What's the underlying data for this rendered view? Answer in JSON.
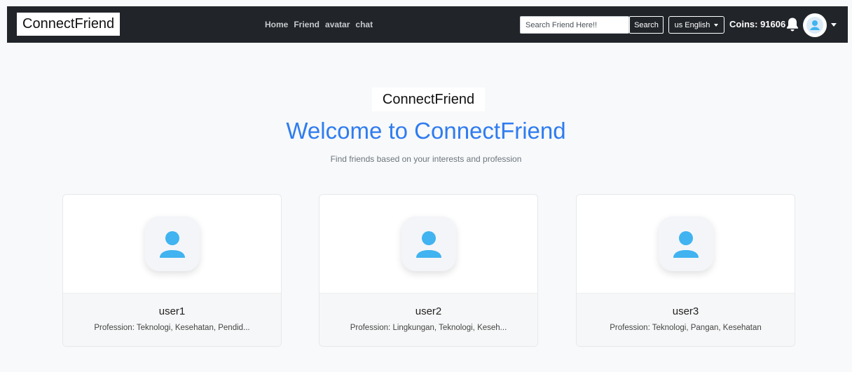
{
  "navbar": {
    "brand": "ConnectFriend",
    "links": [
      "Home",
      "Friend",
      "avatar",
      "chat"
    ],
    "search": {
      "placeholder": "Search Friend Here!!",
      "value": "",
      "button_label": "Search"
    },
    "language": {
      "flag": "us",
      "label": "English"
    },
    "coins": {
      "label": "Coins:",
      "value": "91606"
    }
  },
  "hero": {
    "logo_text": "ConnectFriend",
    "title": "Welcome to ConnectFriend",
    "subtitle": "Find friends based on your interests and profession"
  },
  "users": [
    {
      "name": "user1",
      "profession": "Profession: Teknologi, Kesehatan, Pendid..."
    },
    {
      "name": "user2",
      "profession": "Profession: Lingkungan, Teknologi, Keseh..."
    },
    {
      "name": "user3",
      "profession": "Profession: Teknologi, Pangan, Kesehatan"
    }
  ],
  "icons": {
    "notification": "bell-icon",
    "profile": "user-avatar-icon",
    "dropdown": "caret-down-icon"
  },
  "colors": {
    "navbar_bg": "#212529",
    "accent_title": "#2f7cf0",
    "avatar_blue": "#40b3f0",
    "page_bg": "#f8f9fa"
  }
}
